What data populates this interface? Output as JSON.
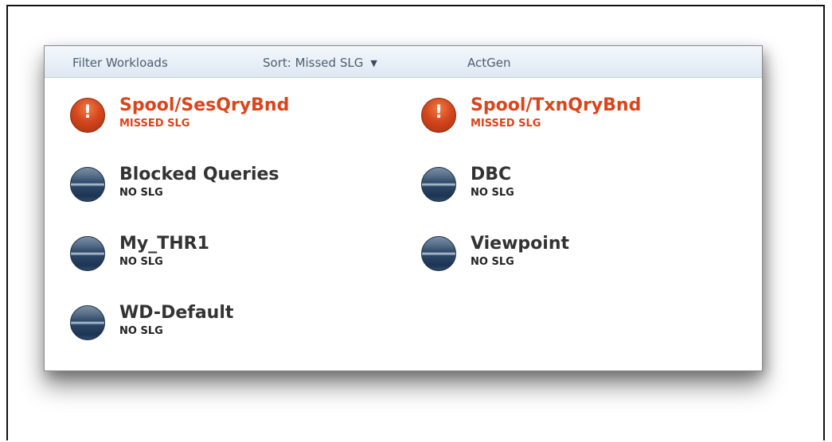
{
  "toolbar": {
    "filter_label": "Filter Workloads",
    "sort_label": "Sort: Missed SLG",
    "sort_caret": "▼",
    "actgen_label": "ActGen"
  },
  "workloads": [
    {
      "name": "Spool/SesQryBnd",
      "status": "MISSED SLG",
      "icon": "exclamation-icon"
    },
    {
      "name": "Spool/TxnQryBnd",
      "status": "MISSED SLG",
      "icon": "exclamation-icon"
    },
    {
      "name": "Blocked Queries",
      "status": "NO SLG",
      "icon": "status-orb-icon"
    },
    {
      "name": "DBC",
      "status": "NO SLG",
      "icon": "status-orb-icon"
    },
    {
      "name": "My_THR1",
      "status": "NO SLG",
      "icon": "status-orb-icon"
    },
    {
      "name": "Viewpoint",
      "status": "NO SLG",
      "icon": "status-orb-icon"
    },
    {
      "name": "WD-Default",
      "status": "NO SLG",
      "icon": "status-orb-icon"
    }
  ],
  "icons": {
    "missed_glyph": "!"
  },
  "colors": {
    "missed": "#d9451c",
    "ok_text": "#333333",
    "toolbar_bg": "#dde8f3"
  }
}
